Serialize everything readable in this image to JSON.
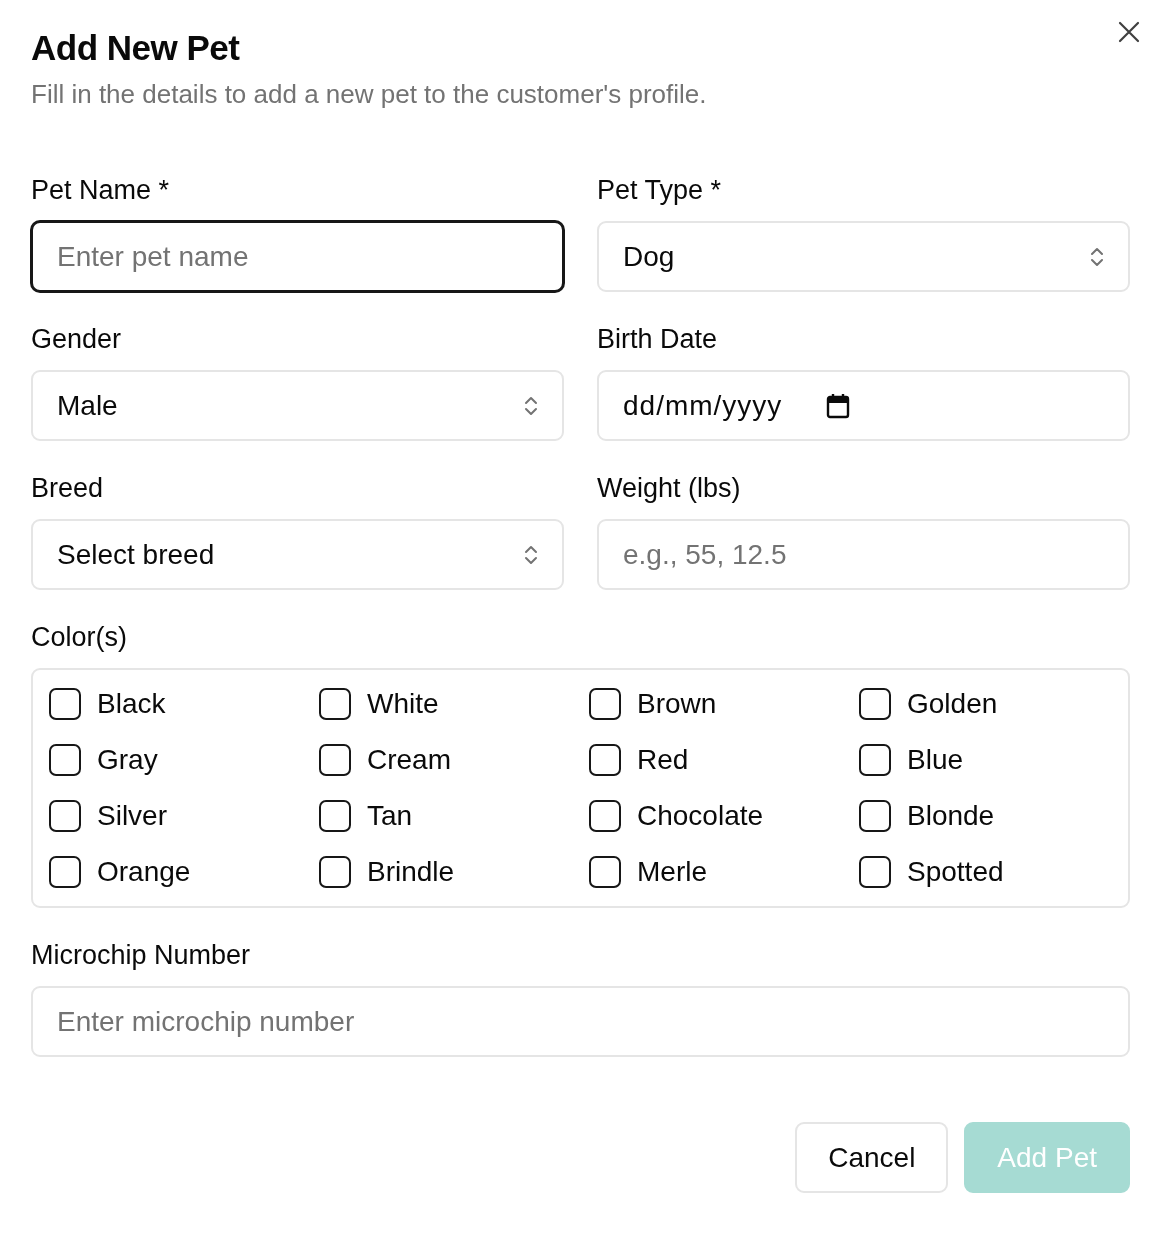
{
  "dialog": {
    "title": "Add New Pet",
    "subtitle": "Fill in the details to add a new pet to the customer's profile."
  },
  "fields": [
    {
      "kind": "text",
      "label": "Pet Name *",
      "placeholder": "Enter pet name",
      "focused": true
    },
    {
      "kind": "select",
      "label": "Pet Type *",
      "value": "Dog",
      "focused": false
    },
    {
      "kind": "select",
      "label": "Gender",
      "value": "Male",
      "focused": false
    },
    {
      "kind": "date",
      "label": "Birth Date",
      "value": "dd/mm/yyyy",
      "focused": false
    },
    {
      "kind": "select",
      "label": "Breed",
      "value": "Select breed",
      "focused": false
    },
    {
      "kind": "text",
      "label": "Weight (lbs)",
      "placeholder": "e.g., 55, 12.5",
      "focused": false
    }
  ],
  "colors": {
    "label": "Color(s)",
    "options": [
      {
        "label": "Black",
        "checked": false
      },
      {
        "label": "White",
        "checked": false
      },
      {
        "label": "Brown",
        "checked": false
      },
      {
        "label": "Golden",
        "checked": false
      },
      {
        "label": "Gray",
        "checked": false
      },
      {
        "label": "Cream",
        "checked": false
      },
      {
        "label": "Red",
        "checked": false
      },
      {
        "label": "Blue",
        "checked": false
      },
      {
        "label": "Silver",
        "checked": false
      },
      {
        "label": "Tan",
        "checked": false
      },
      {
        "label": "Chocolate",
        "checked": false
      },
      {
        "label": "Blonde",
        "checked": false
      },
      {
        "label": "Orange",
        "checked": false
      },
      {
        "label": "Brindle",
        "checked": false
      },
      {
        "label": "Merle",
        "checked": false
      },
      {
        "label": "Spotted",
        "checked": false
      }
    ]
  },
  "microchip": {
    "label": "Microchip Number",
    "placeholder": "Enter microchip number"
  },
  "buttons": [
    {
      "kind": "secondary",
      "label": "Cancel",
      "disabled": false
    },
    {
      "kind": "primary",
      "label": "Add Pet",
      "disabled": true
    }
  ]
}
